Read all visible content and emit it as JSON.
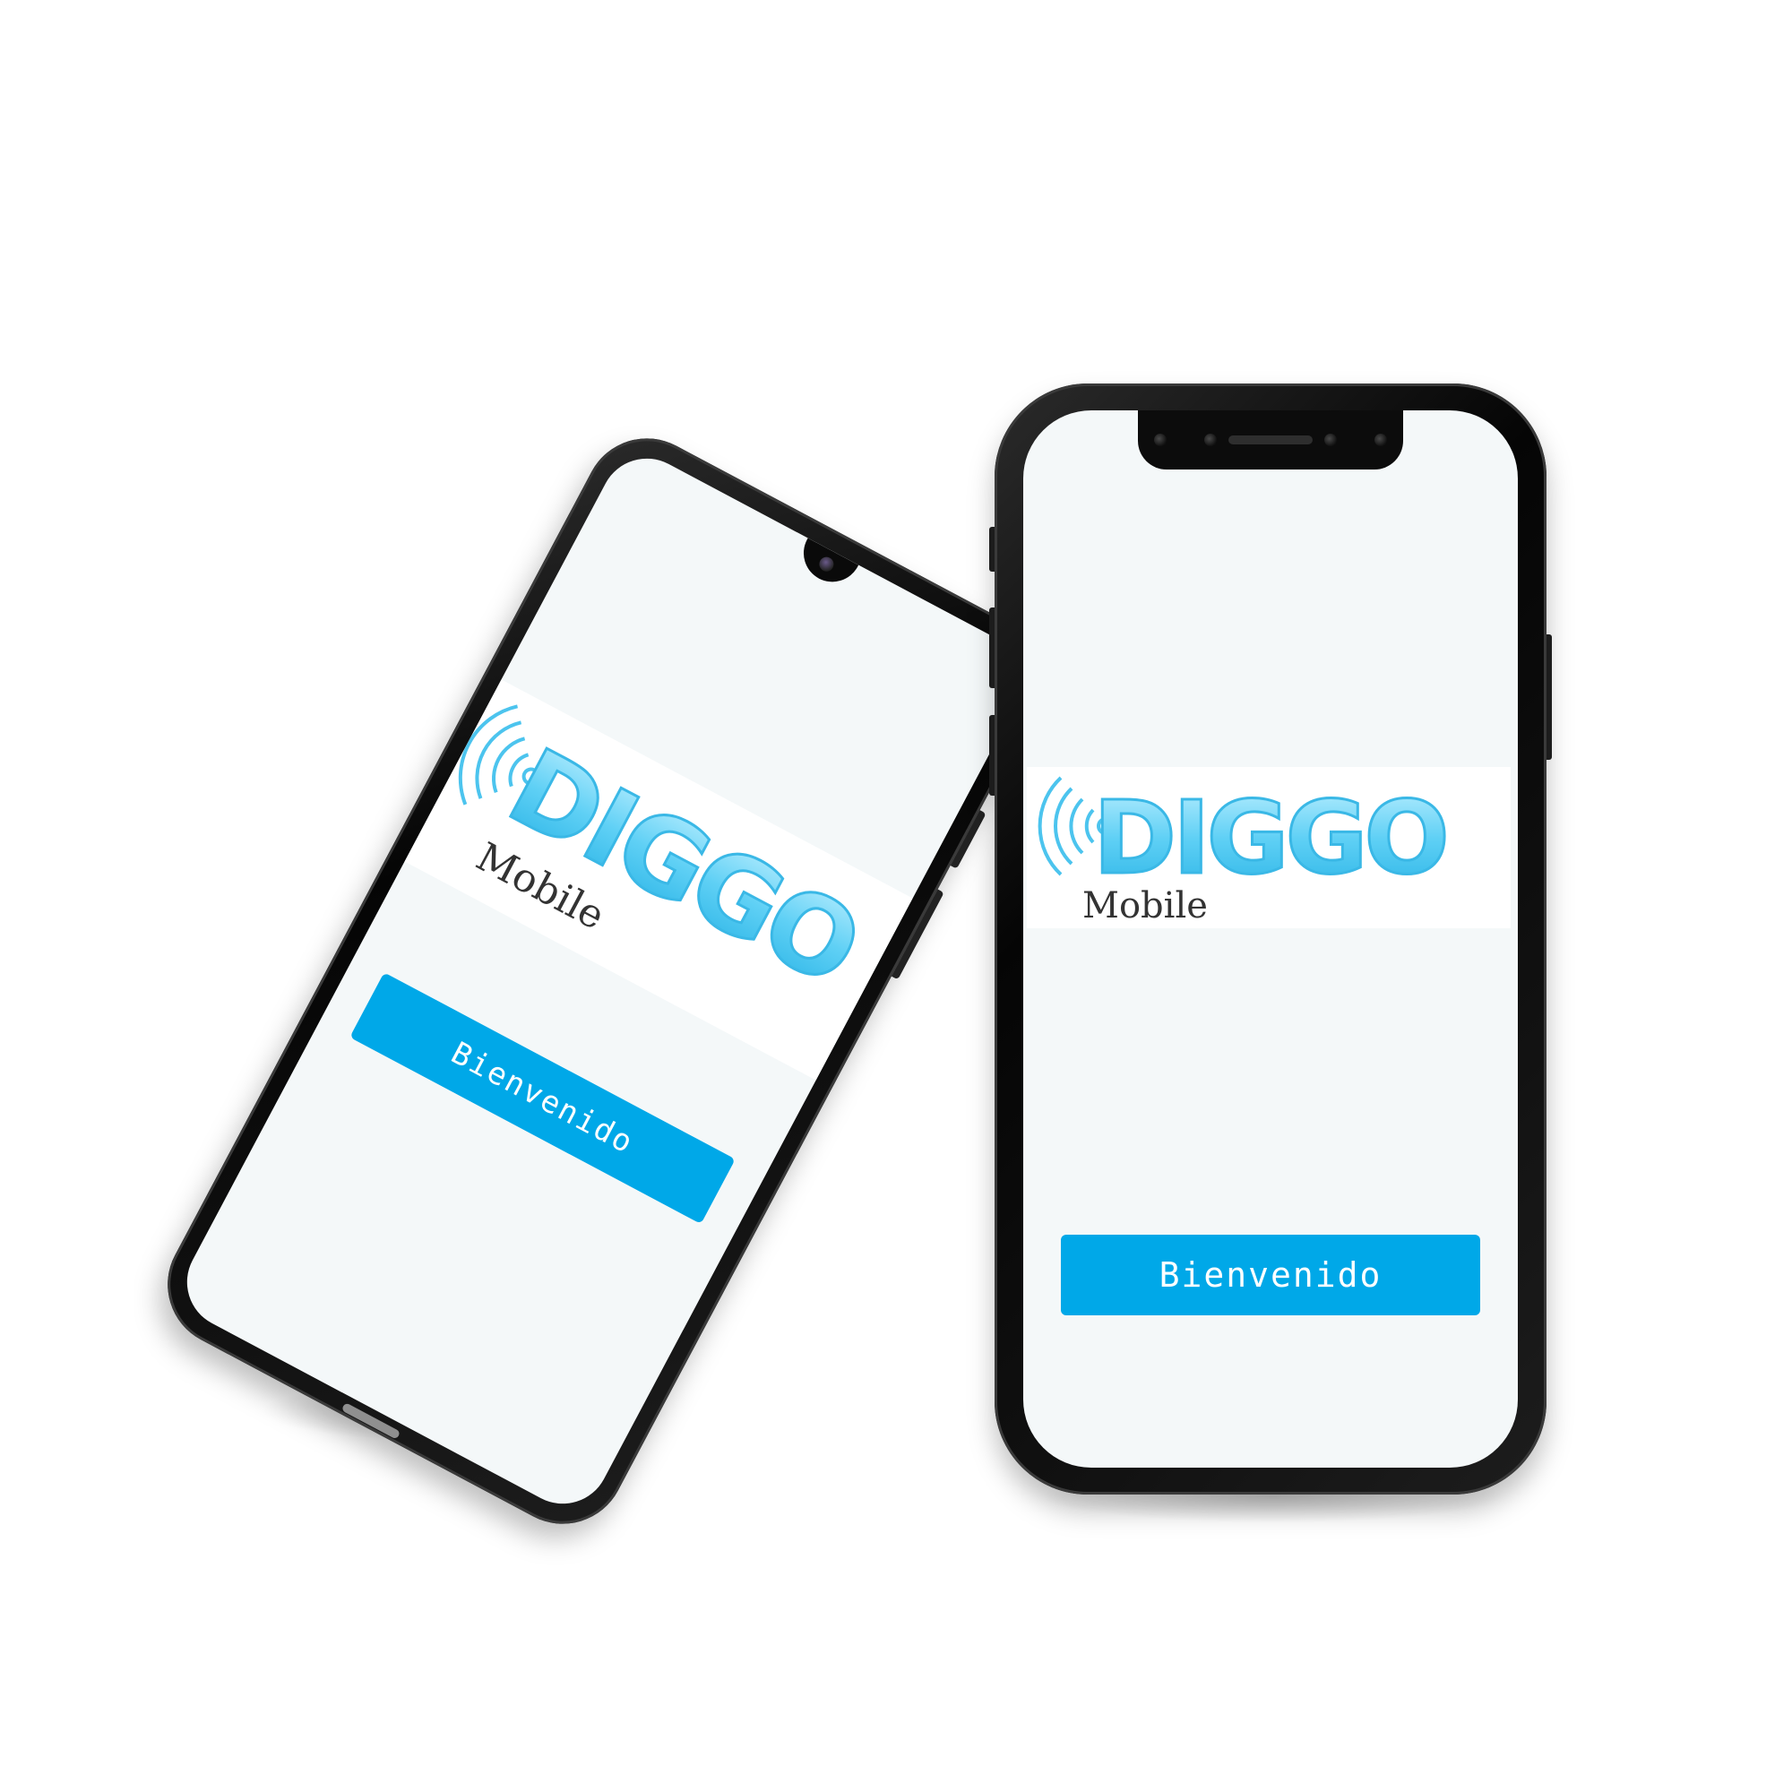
{
  "left_phone": {
    "brand_primary": "DIGGO",
    "brand_secondary": "Mobile",
    "welcome_label": "Bienvenido"
  },
  "right_phone": {
    "brand_primary": "DIGGO",
    "brand_secondary": "Mobile",
    "welcome_label": "Bienvenido"
  },
  "icons": {
    "signal": "wireless-signal-icon",
    "camera": "front-camera-icon"
  },
  "colors": {
    "accent": "#00a8e8",
    "logo_blue": "#5fd0f5",
    "screen": "#f4f8f9",
    "frame": "#0a0a0a"
  }
}
